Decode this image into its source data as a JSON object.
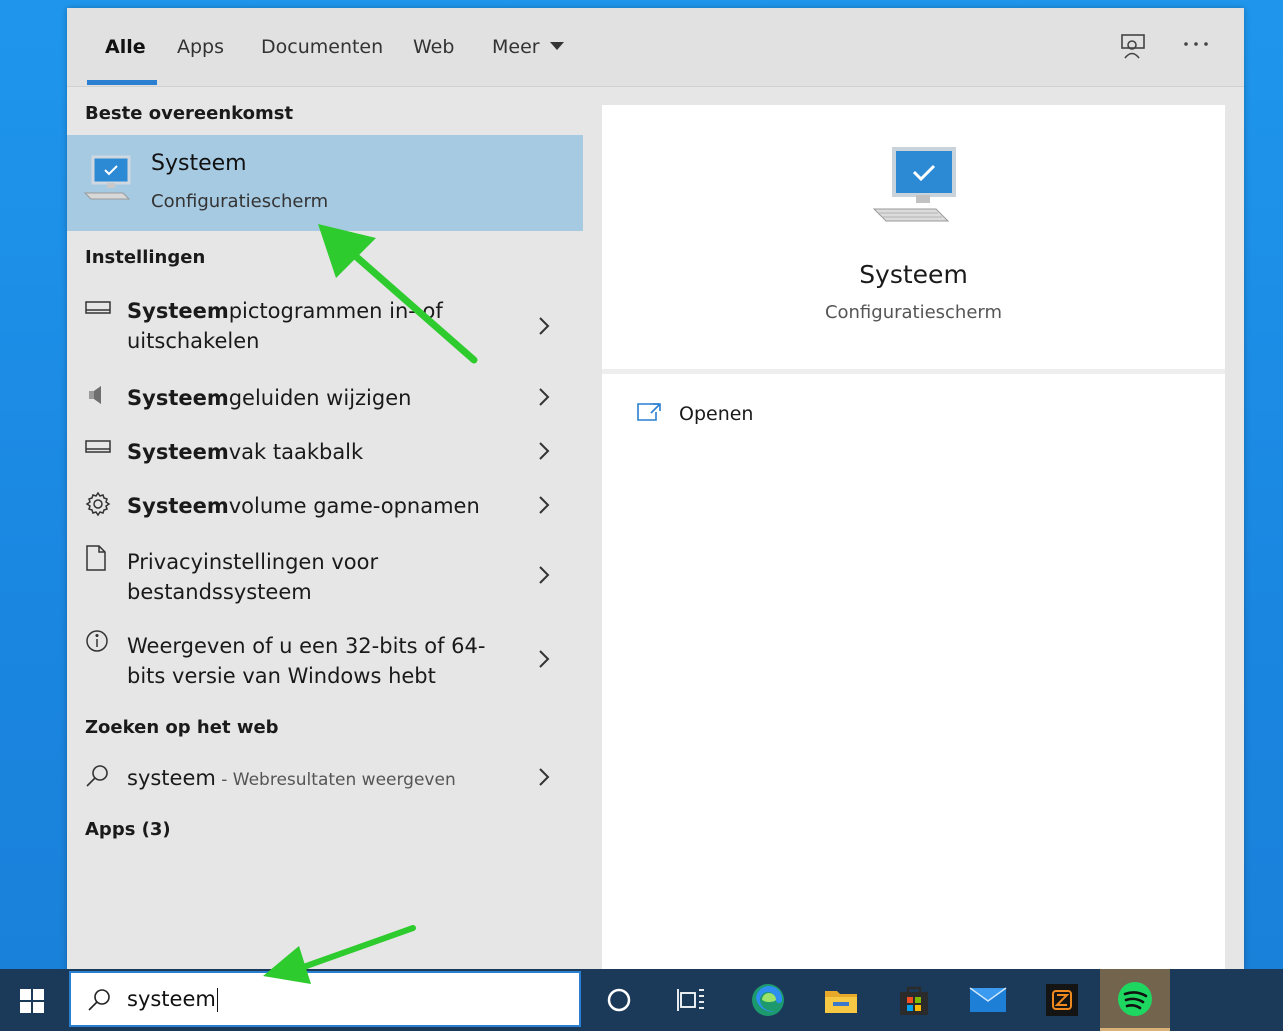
{
  "tabs": [
    {
      "label": "Alle",
      "active": true
    },
    {
      "label": "Apps"
    },
    {
      "label": "Documenten"
    },
    {
      "label": "Web"
    },
    {
      "label": "Meer"
    }
  ],
  "header_icons": [
    "feedback-icon",
    "more-options-icon"
  ],
  "sections": {
    "best_match": "Beste overeenkomst",
    "settings": "Instellingen",
    "web": "Zoeken op het web",
    "apps": "Apps (3)"
  },
  "best_match": {
    "title": "Systeem",
    "subtitle": "Configuratiescherm",
    "icon": "computer-monitor-icon"
  },
  "settings_items": [
    {
      "bold": "Systeem",
      "rest_line1": "pictogrammen in- of",
      "line2": "uitschakelen",
      "icon": "display-icon"
    },
    {
      "bold": "Systeem",
      "rest_line1": "geluiden wijzigen",
      "icon": "speaker-icon"
    },
    {
      "bold": "Systeem",
      "rest_line1": "vak taakbalk",
      "icon": "display-icon"
    },
    {
      "bold": "Systeem",
      "rest_line1": "volume game-opnamen",
      "icon": "gear-icon"
    },
    {
      "line1": "Privacyinstellingen voor",
      "line2": "bestandssysteem",
      "icon": "document-icon"
    },
    {
      "line1": "Weergeven of u een 32-bits of 64-",
      "line2": "bits versie van Windows hebt",
      "icon": "info-icon"
    }
  ],
  "web_item": {
    "query": "systeem",
    "suffix": " - Webresultaten weergeven",
    "icon": "search-icon"
  },
  "preview": {
    "title": "Systeem",
    "subtitle": "Configuratiescherm",
    "action_label": "Openen",
    "action_icon": "open-external-icon"
  },
  "taskbar": {
    "search_value": "systeem",
    "apps": [
      "cortana-icon",
      "task-view-icon",
      "edge-icon",
      "file-explorer-icon",
      "store-icon",
      "mail-icon",
      "ziggo-icon",
      "spotify-icon"
    ]
  },
  "colors": {
    "accent": "#2a7fd0",
    "selection": "#a6cae2",
    "annotation_arrow": "#2ecb2e",
    "taskbar": "#1b3a5a"
  }
}
